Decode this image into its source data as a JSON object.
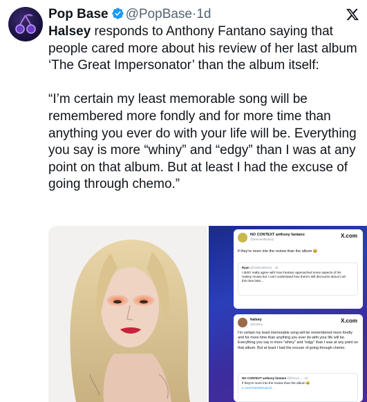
{
  "post": {
    "display_name": "Pop Base",
    "handle": "@PopBase",
    "separator": "·",
    "time": "1d",
    "body_lead": "Halsey",
    "body_rest": " responds to Anthony Fantano saying that people cared more about his review of her last album ‘The Great Impersonator’ than the album itself:\n\n“I’m certain my least memorable song will be remembered more fondly and for more time than anything you ever do with your life will be. Everything you say is more “whiny” and “edgy” than I was at any point on that album. But at least I had the excuse of going through chemo.”",
    "verified_color": "#1d9bf0"
  },
  "icons": {
    "avatar": "cherry-logo-icon",
    "verified": "verified-badge-icon",
    "platform": "x-logo-icon"
  },
  "media": {
    "card1": {
      "name": "NO CONTEXT anthony fantano",
      "handle": "@theneedledrop",
      "platform": "X.com",
      "text": "if they're more into the review than the album 😂",
      "quote_name": "Ryan",
      "quote_meta": "@NotRealMusic · 4h",
      "quote_text": "I didn't really agree with how Fantano approached some aspects of his Halsey review but I can't understand how there's still discourse about it all this time later..."
    },
    "card2": {
      "name": "halsey",
      "handle": "@halsey",
      "platform": "X.com",
      "text": "I'm certain my least memorable song will be remembered more fondly and for more time than anything you ever do with your life will be. Everything you say is more \"whiny\" and \"edgy\" than I was at any point on that album. But at least I had the excuse of going through chemo.",
      "quote_name": "NO CONTEXT anthony fantano",
      "quote_meta": "@theneе... · 2h",
      "quote_text": "if they're more into the review than the album 😂",
      "quote_link": "x.com/notrealmusic/s..."
    }
  }
}
